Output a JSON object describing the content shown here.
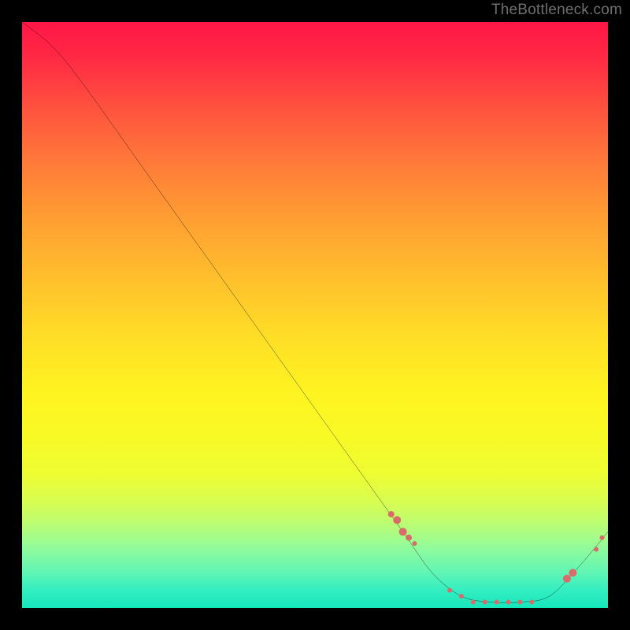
{
  "watermark": "TheBottleneck.com",
  "chart_data": {
    "type": "line",
    "title": "",
    "xlabel": "",
    "ylabel": "",
    "xlim": [
      0,
      100
    ],
    "ylim": [
      0,
      100
    ],
    "grid": false,
    "legend": false,
    "background": "red-to-green vertical gradient",
    "curve": {
      "name": "bottleneck-curve",
      "color": "#000000",
      "points": [
        {
          "x": 0,
          "y": 100
        },
        {
          "x": 5,
          "y": 96
        },
        {
          "x": 10,
          "y": 90
        },
        {
          "x": 20,
          "y": 76
        },
        {
          "x": 30,
          "y": 62
        },
        {
          "x": 40,
          "y": 48
        },
        {
          "x": 50,
          "y": 34
        },
        {
          "x": 55,
          "y": 27
        },
        {
          "x": 60,
          "y": 20
        },
        {
          "x": 65,
          "y": 13
        },
        {
          "x": 70,
          "y": 6
        },
        {
          "x": 75,
          "y": 2
        },
        {
          "x": 80,
          "y": 1
        },
        {
          "x": 85,
          "y": 1
        },
        {
          "x": 90,
          "y": 2
        },
        {
          "x": 95,
          "y": 7
        },
        {
          "x": 100,
          "y": 13
        }
      ]
    },
    "markers": {
      "color": "#d96b6b",
      "points": [
        {
          "x": 63,
          "y": 16,
          "r": 4
        },
        {
          "x": 64,
          "y": 15,
          "r": 5
        },
        {
          "x": 65,
          "y": 13,
          "r": 5
        },
        {
          "x": 66,
          "y": 12,
          "r": 4
        },
        {
          "x": 67,
          "y": 11,
          "r": 3
        },
        {
          "x": 73,
          "y": 3,
          "r": 3
        },
        {
          "x": 75,
          "y": 2,
          "r": 3
        },
        {
          "x": 77,
          "y": 1,
          "r": 3
        },
        {
          "x": 79,
          "y": 1,
          "r": 3
        },
        {
          "x": 81,
          "y": 1,
          "r": 3
        },
        {
          "x": 83,
          "y": 1,
          "r": 3
        },
        {
          "x": 85,
          "y": 1,
          "r": 3
        },
        {
          "x": 87,
          "y": 1,
          "r": 3
        },
        {
          "x": 93,
          "y": 5,
          "r": 5
        },
        {
          "x": 94,
          "y": 6,
          "r": 5
        },
        {
          "x": 98,
          "y": 10,
          "r": 3
        },
        {
          "x": 99,
          "y": 12,
          "r": 3
        }
      ]
    }
  }
}
